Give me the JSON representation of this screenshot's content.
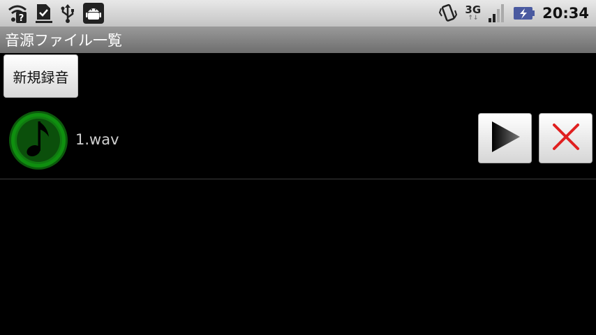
{
  "status_bar": {
    "left_icons": [
      "wifi-question-icon",
      "download-done-icon",
      "usb-icon",
      "android-debug-icon"
    ],
    "right_icons": [
      "vibrate-icon",
      "signal-icon",
      "battery-charging-icon"
    ],
    "network_type": "3G",
    "time": "20:34"
  },
  "title_bar": {
    "title": "音源ファイル一覧"
  },
  "new_recording_button": {
    "label": "新規録音"
  },
  "files": [
    {
      "name": "1.wav",
      "icon": "music-note-icon",
      "play_icon": "play-icon",
      "delete_icon": "delete-x-icon"
    }
  ],
  "colors": {
    "status_bar_bg": "#d6d6d6",
    "title_bar_bg": "#848484",
    "background": "#000000",
    "icon_green": "#0f8f0f",
    "delete_red": "#e02020"
  }
}
